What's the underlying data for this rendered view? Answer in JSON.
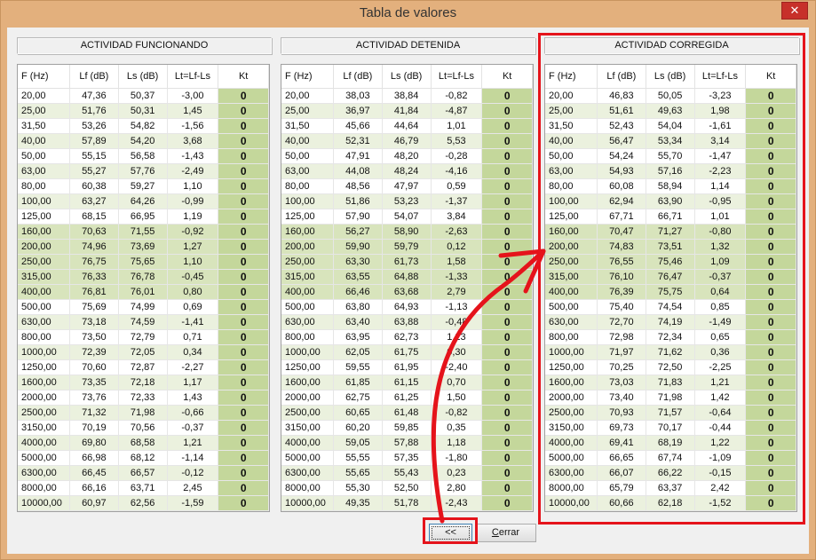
{
  "window": {
    "title": "Tabla de valores",
    "close_glyph": "✕"
  },
  "columns": [
    "F (Hz)",
    "Lf (dB)",
    "Ls (dB)",
    "Lt=Lf-Ls",
    "Kt"
  ],
  "frequencies": [
    "20,00",
    "25,00",
    "31,50",
    "40,00",
    "50,00",
    "63,00",
    "80,00",
    "100,00",
    "125,00",
    "160,00",
    "200,00",
    "250,00",
    "315,00",
    "400,00",
    "500,00",
    "630,00",
    "800,00",
    "1000,00",
    "1250,00",
    "1600,00",
    "2000,00",
    "2500,00",
    "3150,00",
    "4000,00",
    "5000,00",
    "6300,00",
    "8000,00",
    "10000,00"
  ],
  "highlighted_rows": [
    9,
    10,
    11,
    12,
    13
  ],
  "panels": [
    {
      "title": "ACTIVIDAD FUNCIONANDO",
      "rows": [
        [
          "47,36",
          "50,37",
          "-3,00",
          "0"
        ],
        [
          "51,76",
          "50,31",
          "1,45",
          "0"
        ],
        [
          "53,26",
          "54,82",
          "-1,56",
          "0"
        ],
        [
          "57,89",
          "54,20",
          "3,68",
          "0"
        ],
        [
          "55,15",
          "56,58",
          "-1,43",
          "0"
        ],
        [
          "55,27",
          "57,76",
          "-2,49",
          "0"
        ],
        [
          "60,38",
          "59,27",
          "1,10",
          "0"
        ],
        [
          "63,27",
          "64,26",
          "-0,99",
          "0"
        ],
        [
          "68,15",
          "66,95",
          "1,19",
          "0"
        ],
        [
          "70,63",
          "71,55",
          "-0,92",
          "0"
        ],
        [
          "74,96",
          "73,69",
          "1,27",
          "0"
        ],
        [
          "76,75",
          "75,65",
          "1,10",
          "0"
        ],
        [
          "76,33",
          "76,78",
          "-0,45",
          "0"
        ],
        [
          "76,81",
          "76,01",
          "0,80",
          "0"
        ],
        [
          "75,69",
          "74,99",
          "0,69",
          "0"
        ],
        [
          "73,18",
          "74,59",
          "-1,41",
          "0"
        ],
        [
          "73,50",
          "72,79",
          "0,71",
          "0"
        ],
        [
          "72,39",
          "72,05",
          "0,34",
          "0"
        ],
        [
          "70,60",
          "72,87",
          "-2,27",
          "0"
        ],
        [
          "73,35",
          "72,18",
          "1,17",
          "0"
        ],
        [
          "73,76",
          "72,33",
          "1,43",
          "0"
        ],
        [
          "71,32",
          "71,98",
          "-0,66",
          "0"
        ],
        [
          "70,19",
          "70,56",
          "-0,37",
          "0"
        ],
        [
          "69,80",
          "68,58",
          "1,21",
          "0"
        ],
        [
          "66,98",
          "68,12",
          "-1,14",
          "0"
        ],
        [
          "66,45",
          "66,57",
          "-0,12",
          "0"
        ],
        [
          "66,16",
          "63,71",
          "2,45",
          "0"
        ],
        [
          "60,97",
          "62,56",
          "-1,59",
          "0"
        ]
      ]
    },
    {
      "title": "ACTIVIDAD DETENIDA",
      "rows": [
        [
          "38,03",
          "38,84",
          "-0,82",
          "0"
        ],
        [
          "36,97",
          "41,84",
          "-4,87",
          "0"
        ],
        [
          "45,66",
          "44,64",
          "1,01",
          "0"
        ],
        [
          "52,31",
          "46,79",
          "5,53",
          "0"
        ],
        [
          "47,91",
          "48,20",
          "-0,28",
          "0"
        ],
        [
          "44,08",
          "48,24",
          "-4,16",
          "0"
        ],
        [
          "48,56",
          "47,97",
          "0,59",
          "0"
        ],
        [
          "51,86",
          "53,23",
          "-1,37",
          "0"
        ],
        [
          "57,90",
          "54,07",
          "3,84",
          "0"
        ],
        [
          "56,27",
          "58,90",
          "-2,63",
          "0"
        ],
        [
          "59,90",
          "59,79",
          "0,12",
          "0"
        ],
        [
          "63,30",
          "61,73",
          "1,58",
          "0"
        ],
        [
          "63,55",
          "64,88",
          "-1,33",
          "0"
        ],
        [
          "66,46",
          "63,68",
          "2,79",
          "0"
        ],
        [
          "63,80",
          "64,93",
          "-1,13",
          "0"
        ],
        [
          "63,40",
          "63,88",
          "-0,48",
          "0"
        ],
        [
          "63,95",
          "62,73",
          "1,23",
          "0"
        ],
        [
          "62,05",
          "61,75",
          "0,30",
          "0"
        ],
        [
          "59,55",
          "61,95",
          "-2,40",
          "0"
        ],
        [
          "61,85",
          "61,15",
          "0,70",
          "0"
        ],
        [
          "62,75",
          "61,25",
          "1,50",
          "0"
        ],
        [
          "60,65",
          "61,48",
          "-0,82",
          "0"
        ],
        [
          "60,20",
          "59,85",
          "0,35",
          "0"
        ],
        [
          "59,05",
          "57,88",
          "1,18",
          "0"
        ],
        [
          "55,55",
          "57,35",
          "-1,80",
          "0"
        ],
        [
          "55,65",
          "55,43",
          "0,23",
          "0"
        ],
        [
          "55,30",
          "52,50",
          "2,80",
          "0"
        ],
        [
          "49,35",
          "51,78",
          "-2,43",
          "0"
        ]
      ]
    },
    {
      "title": "ACTIVIDAD CORREGIDA",
      "rows": [
        [
          "46,83",
          "50,05",
          "-3,23",
          "0"
        ],
        [
          "51,61",
          "49,63",
          "1,98",
          "0"
        ],
        [
          "52,43",
          "54,04",
          "-1,61",
          "0"
        ],
        [
          "56,47",
          "53,34",
          "3,14",
          "0"
        ],
        [
          "54,24",
          "55,70",
          "-1,47",
          "0"
        ],
        [
          "54,93",
          "57,16",
          "-2,23",
          "0"
        ],
        [
          "60,08",
          "58,94",
          "1,14",
          "0"
        ],
        [
          "62,94",
          "63,90",
          "-0,95",
          "0"
        ],
        [
          "67,71",
          "66,71",
          "1,01",
          "0"
        ],
        [
          "70,47",
          "71,27",
          "-0,80",
          "0"
        ],
        [
          "74,83",
          "73,51",
          "1,32",
          "0"
        ],
        [
          "76,55",
          "75,46",
          "1,09",
          "0"
        ],
        [
          "76,10",
          "76,47",
          "-0,37",
          "0"
        ],
        [
          "76,39",
          "75,75",
          "0,64",
          "0"
        ],
        [
          "75,40",
          "74,54",
          "0,85",
          "0"
        ],
        [
          "72,70",
          "74,19",
          "-1,49",
          "0"
        ],
        [
          "72,98",
          "72,34",
          "0,65",
          "0"
        ],
        [
          "71,97",
          "71,62",
          "0,36",
          "0"
        ],
        [
          "70,25",
          "72,50",
          "-2,25",
          "0"
        ],
        [
          "73,03",
          "71,83",
          "1,21",
          "0"
        ],
        [
          "73,40",
          "71,98",
          "1,42",
          "0"
        ],
        [
          "70,93",
          "71,57",
          "-0,64",
          "0"
        ],
        [
          "69,73",
          "70,17",
          "-0,44",
          "0"
        ],
        [
          "69,41",
          "68,19",
          "1,22",
          "0"
        ],
        [
          "66,65",
          "67,74",
          "-1,09",
          "0"
        ],
        [
          "66,07",
          "66,22",
          "-0,15",
          "0"
        ],
        [
          "65,79",
          "63,37",
          "2,42",
          "0"
        ],
        [
          "60,66",
          "62,18",
          "-1,52",
          "0"
        ]
      ]
    }
  ],
  "buttons": {
    "back_label": "<<",
    "close_mnemonic": "C",
    "close_rest": "errar"
  },
  "annotation": {
    "color": "#e5131b"
  }
}
